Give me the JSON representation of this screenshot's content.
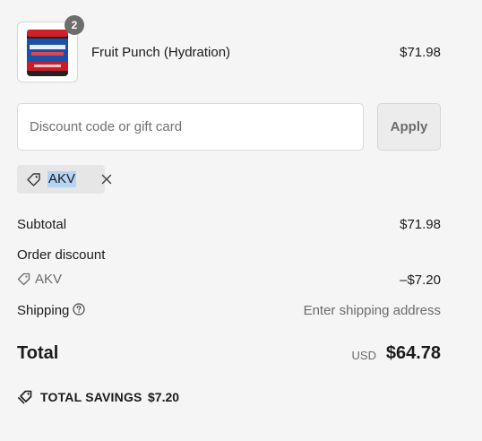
{
  "cart": {
    "item": {
      "name": "Fruit Punch (Hydration)",
      "price": "$71.98",
      "quantity": "2",
      "image_text": "ROGUE HYDRATION",
      "image_subtext": "FRUIT PUNCH"
    }
  },
  "discount": {
    "placeholder": "Discount code or gift card",
    "apply_label": "Apply",
    "applied_code": "AKV"
  },
  "summary": {
    "subtotal_label": "Subtotal",
    "subtotal_value": "$71.98",
    "order_discount_label": "Order discount",
    "discount_code": "AKV",
    "discount_amount": "–$7.20",
    "shipping_label": "Shipping",
    "shipping_value": "Enter shipping address",
    "total_label": "Total",
    "total_currency": "USD",
    "total_value": "$64.78",
    "savings_label": "TOTAL SAVINGS",
    "savings_amount": "$7.20"
  },
  "colors": {
    "background": "#f5f5f5",
    "highlight": "#b5d3f5",
    "badge": "#6d6d6d"
  }
}
